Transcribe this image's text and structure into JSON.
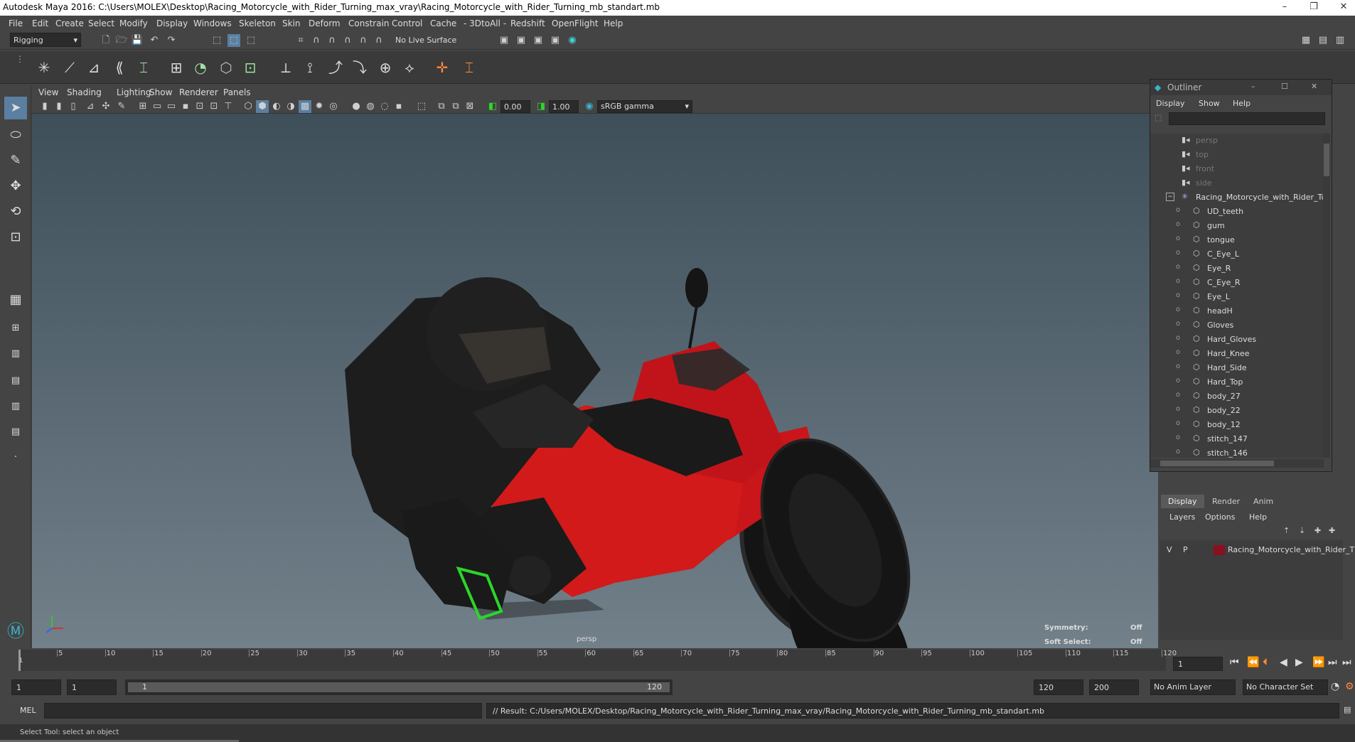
{
  "window": {
    "title": "Autodesk Maya 2016: C:\\Users\\MOLEX\\Desktop\\Racing_Motorcycle_with_Rider_Turning_max_vray\\Racing_Motorcycle_with_Rider_Turning_mb_standart.mb",
    "controls": [
      "–",
      "❐",
      "✕"
    ]
  },
  "menubar": [
    "File",
    "Edit",
    "Create",
    "Select",
    "Modify",
    "Display",
    "Windows",
    "Skeleton",
    "Skin",
    "Deform",
    "Constrain",
    "Control",
    "Cache",
    "- 3DtoAll -",
    "Redshift",
    "OpenFlight",
    "Help"
  ],
  "statusline": {
    "menu_set": "Rigging",
    "live_surface": "No Live Surface"
  },
  "viewport": {
    "menu": [
      "View",
      "Shading",
      "Lighting",
      "Show",
      "Renderer",
      "Panels"
    ],
    "exposure": "0.00",
    "gamma": "1.00",
    "color_space": "sRGB gamma",
    "camera_label": "persp",
    "symmetry_label": "Symmetry:",
    "symmetry_value": "Off",
    "soft_select_label": "Soft Select:",
    "soft_select_value": "Off",
    "colors": {
      "bike_red": "#d21a1a",
      "accent_green": "#2bd62b"
    }
  },
  "outliner": {
    "title": "Outliner",
    "menu": [
      "Display",
      "Show",
      "Help"
    ],
    "items": [
      {
        "name": "persp",
        "dim": true,
        "type": "camera",
        "indent": 1
      },
      {
        "name": "top",
        "dim": true,
        "type": "camera",
        "indent": 1
      },
      {
        "name": "front",
        "dim": true,
        "type": "camera",
        "indent": 1
      },
      {
        "name": "side",
        "dim": true,
        "type": "camera",
        "indent": 1
      },
      {
        "name": "Racing_Motorcycle_with_Rider_Tur",
        "dim": false,
        "type": "group",
        "indent": 1
      },
      {
        "name": "UD_teeth",
        "dim": false,
        "type": "mesh",
        "indent": 2
      },
      {
        "name": "gum",
        "dim": false,
        "type": "mesh",
        "indent": 2
      },
      {
        "name": "tongue",
        "dim": false,
        "type": "mesh",
        "indent": 2
      },
      {
        "name": "C_Eye_L",
        "dim": false,
        "type": "mesh",
        "indent": 2
      },
      {
        "name": "Eye_R",
        "dim": false,
        "type": "mesh",
        "indent": 2
      },
      {
        "name": "C_Eye_R",
        "dim": false,
        "type": "mesh",
        "indent": 2
      },
      {
        "name": "Eye_L",
        "dim": false,
        "type": "mesh",
        "indent": 2
      },
      {
        "name": "headH",
        "dim": false,
        "type": "mesh",
        "indent": 2
      },
      {
        "name": "Gloves",
        "dim": false,
        "type": "mesh",
        "indent": 2
      },
      {
        "name": "Hard_Gloves",
        "dim": false,
        "type": "mesh",
        "indent": 2
      },
      {
        "name": "Hard_Knee",
        "dim": false,
        "type": "mesh",
        "indent": 2
      },
      {
        "name": "Hard_Side",
        "dim": false,
        "type": "mesh",
        "indent": 2
      },
      {
        "name": "Hard_Top",
        "dim": false,
        "type": "mesh",
        "indent": 2
      },
      {
        "name": "body_27",
        "dim": false,
        "type": "mesh",
        "indent": 2
      },
      {
        "name": "body_22",
        "dim": false,
        "type": "mesh",
        "indent": 2
      },
      {
        "name": "body_12",
        "dim": false,
        "type": "mesh",
        "indent": 2
      },
      {
        "name": "stitch_147",
        "dim": false,
        "type": "mesh",
        "indent": 2
      },
      {
        "name": "stitch_146",
        "dim": false,
        "type": "mesh",
        "indent": 2
      }
    ]
  },
  "layer_editor": {
    "tabs": [
      "Display",
      "Render",
      "Anim"
    ],
    "active_tab": "Display",
    "menu": [
      "Layers",
      "Options",
      "Help"
    ],
    "layer": {
      "v": "V",
      "p": "P",
      "name": "Racing_Motorcycle_with_Rider_T",
      "color": "#8a1020"
    }
  },
  "timeline": {
    "ticks": [
      "5",
      "10",
      "15",
      "20",
      "25",
      "30",
      "35",
      "40",
      "45",
      "50",
      "55",
      "60",
      "65",
      "70",
      "75",
      "80",
      "85",
      "90",
      "95",
      "100",
      "105",
      "110",
      "115",
      "120"
    ],
    "start_tick": "1",
    "current_frame": "1"
  },
  "range": {
    "start": "1",
    "playback_start": "1",
    "slider_start": "1",
    "slider_end": "120",
    "playback_end": "120",
    "end": "200",
    "anim_layer": "No Anim Layer",
    "character_set": "No Character Set"
  },
  "command": {
    "label": "MEL",
    "result": "// Result: C:/Users/MOLEX/Desktop/Racing_Motorcycle_with_Rider_Turning_max_vray/Racing_Motorcycle_with_Rider_Turning_mb_standart.mb"
  },
  "helpline": "Select Tool: select an object"
}
